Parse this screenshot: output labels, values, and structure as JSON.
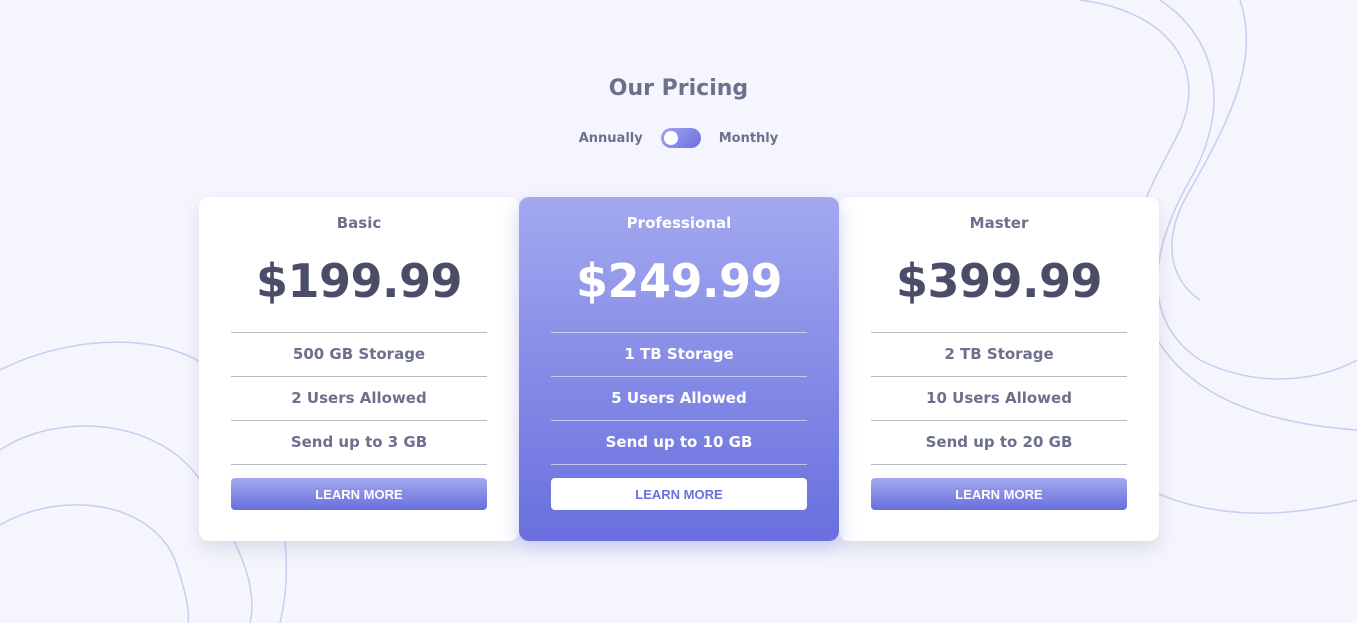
{
  "header": {
    "title": "Our Pricing",
    "toggle_left_label": "Annually",
    "toggle_right_label": "Monthly"
  },
  "colors": {
    "accent_light": "#a3a8f0",
    "accent_dark": "#696fdd",
    "text_primary": "#4a4d68",
    "text_secondary": "#6d708d",
    "background": "#f5f6fd"
  },
  "plans": [
    {
      "name": "Basic",
      "price": "$199.99",
      "features": [
        "500 GB Storage",
        "2 Users Allowed",
        "Send up to 3 GB"
      ],
      "button_label": "LEARN MORE"
    },
    {
      "name": "Professional",
      "price": "$249.99",
      "features": [
        "1 TB Storage",
        "5 Users Allowed",
        "Send up to 10 GB"
      ],
      "button_label": "LEARN MORE"
    },
    {
      "name": "Master",
      "price": "$399.99",
      "features": [
        "2 TB Storage",
        "10 Users Allowed",
        "Send up to 20 GB"
      ],
      "button_label": "LEARN MORE"
    }
  ]
}
